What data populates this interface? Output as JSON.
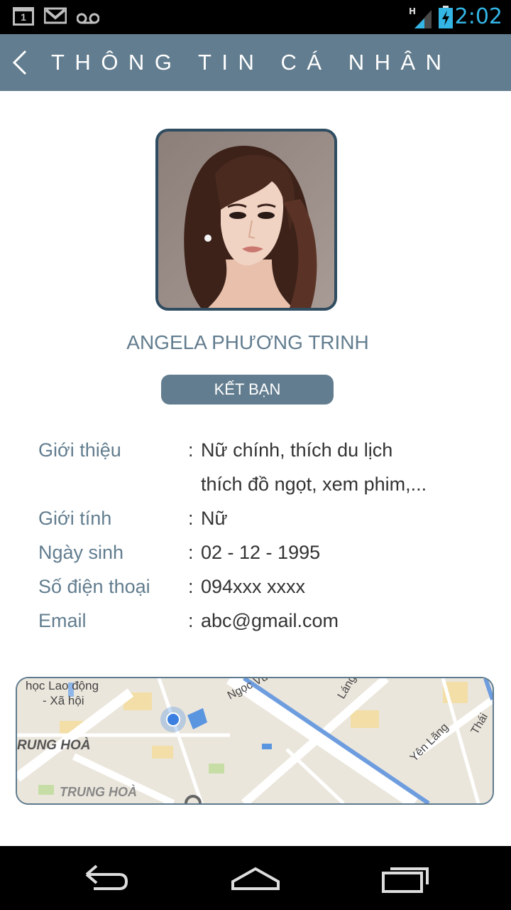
{
  "status_bar": {
    "time": "2:02",
    "calendar_day": "1",
    "network_type": "H",
    "icons": [
      "calendar-icon",
      "gmail-icon",
      "voicemail-icon",
      "signal-icon",
      "battery-charging-icon"
    ]
  },
  "header": {
    "title": "THÔNG TIN CÁ NHÂN",
    "back_icon": "chevron-left-icon"
  },
  "profile": {
    "name": "ANGELA PHƯƠNG TRINH",
    "add_friend_label": "KẾT BẠN"
  },
  "info": [
    {
      "label": "Giới thiệu",
      "value": "Nữ chính, thích du lịch",
      "value_line2": "thích đồ ngọt, xem phim,..."
    },
    {
      "label": "Giới tính",
      "value": "Nữ"
    },
    {
      "label": "Ngày sinh",
      "value": "02 - 12 - 1995"
    },
    {
      "label": "Số điện thoại",
      "value": "094xxx xxxx"
    },
    {
      "label": "Email",
      "value": "abc@gmail.com"
    }
  ],
  "colon": ":",
  "map": {
    "labels": [
      "học Lao động",
      "- Xã hội",
      "RUNG HOÀ",
      "TRUNG HOÀ",
      "Ngọc Vũ",
      "Láng",
      "Yên Lãng",
      "Thái"
    ]
  },
  "colors": {
    "accent": "#627d8f",
    "header_bg": "#627d8f",
    "avatar_border": "#2f4c61",
    "status_time": "#33b5e5"
  },
  "nav_icons": [
    "back-icon",
    "home-icon",
    "recent-apps-icon"
  ]
}
